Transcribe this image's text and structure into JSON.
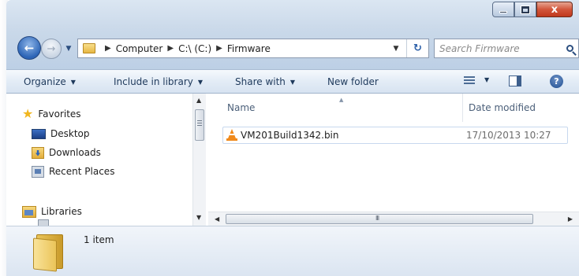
{
  "window": {
    "minimize_icon": "minimize-icon",
    "maximize_icon": "maximize-icon",
    "close_glyph": "x"
  },
  "navigation": {
    "back_glyph": "←",
    "forward_glyph": "→",
    "history_dropdown_glyph": "▼"
  },
  "address": {
    "breadcrumbs": [
      "Computer",
      "C:\\ (C:)",
      "Firmware"
    ],
    "separator": "▶",
    "dropdown_glyph": "▼",
    "refresh_glyph": "↻"
  },
  "search": {
    "placeholder": "Search Firmware"
  },
  "toolbar": {
    "organize": "Organize",
    "include_in_library": "Include in library",
    "share_with": "Share with",
    "new_folder": "New folder",
    "dropdown_arrow": "▼",
    "help_glyph": "?"
  },
  "nav_pane": {
    "favorites": "Favorites",
    "items": [
      {
        "label": "Desktop",
        "icon": "desktop-icon"
      },
      {
        "label": "Downloads",
        "icon": "downloads-icon"
      },
      {
        "label": "Recent Places",
        "icon": "recent-places-icon"
      }
    ],
    "libraries": "Libraries",
    "scroll_up": "▲",
    "scroll_down": "▼"
  },
  "file_list": {
    "columns": [
      "Name",
      "Date modified"
    ],
    "sort_arrow": "▲",
    "files": [
      {
        "name": "VM201Build1342.bin",
        "date_modified": "17/10/2013 10:27",
        "icon": "vlc-cone-icon"
      }
    ],
    "scroll_left": "◀",
    "scroll_right": "▶",
    "scroll_grip": "III"
  },
  "details": {
    "item_count": "1 item"
  },
  "colors": {
    "accent": "#2c64b6",
    "close_button": "#c0391d",
    "toolbar_text": "#1e395b"
  }
}
